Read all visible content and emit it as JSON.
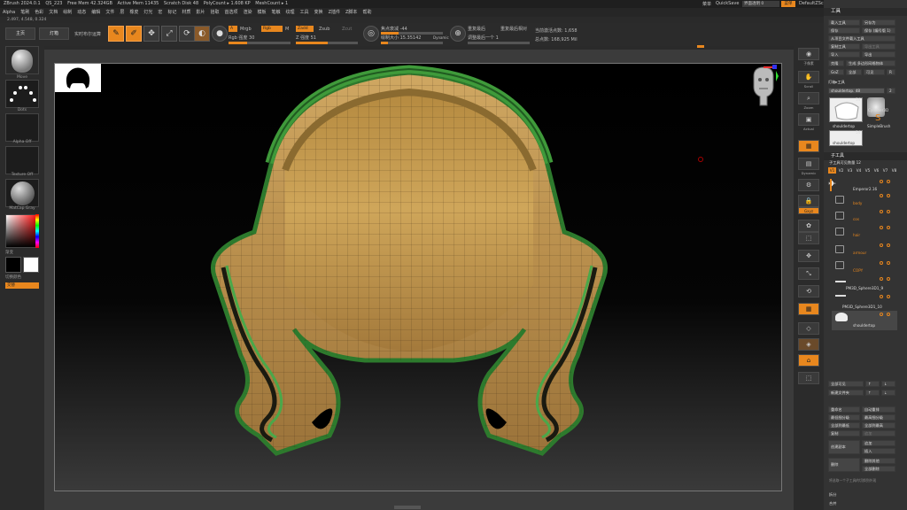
{
  "title_bar": {
    "app": "ZBrush 2024.0.1",
    "doc": "QS_223",
    "free_mem": "Free Mem 42.324GB",
    "active_mem": "Active Mem 11435",
    "scratch_disk": "Scratch Disk 48",
    "poly_count": "PolyCount ▸ 1.608 KP",
    "mesh_count": "MeshCount ▸ 1",
    "menu_label": "菜单",
    "quicksave": "QuickSave",
    "transparency": "界面透明 0",
    "ui_button": "菜单",
    "script": "DefaultZScript"
  },
  "menu": [
    "Alpha",
    "笔刷",
    "色彩",
    "文档",
    "绘制",
    "动态",
    "编辑",
    "文件",
    "层",
    "橡皮",
    "灯光",
    "宏",
    "标记",
    "材质",
    "影片",
    "拾取",
    "首选项",
    "渲染",
    "模板",
    "笔触",
    "纹理",
    "工具",
    "变换",
    "Z插件",
    "Z脚本",
    "帮助"
  ],
  "coords": "2.497, 4.548, 0.324",
  "toolbar": {
    "projection": "主页",
    "lightbox": "灯箱",
    "live_boolean": "实时布尔运算",
    "edit": "Edit",
    "draw": "Draw",
    "move": "Move",
    "scale": "Scale",
    "rotate": "Rotate",
    "a_btn": "A",
    "mrgb": "Mrgb",
    "rgb": "Rgb",
    "m": "M",
    "rgb_intensity_label": "Rgb 强度",
    "rgb_intensity": "30",
    "rgb_intensity_pct": 30,
    "zadd": "Zadd",
    "zsub": "Zsub",
    "zcut": "Zcut",
    "z_intensity_label": "Z 强度",
    "z_intensity": "51",
    "z_intensity_pct": 51,
    "focal_shift": "焦点衰减 -44",
    "focal_shift_pct": 28,
    "draw_size": "绘制大小 15.35142",
    "draw_size_pct": 12,
    "dynamic": "Dynamic",
    "active_points": "当前激活点数: 1,658",
    "total_points": "总点数: 168,925 Mil",
    "backface_mask": "重复最后",
    "backface_relative": "重复最后相对",
    "adjust_last": "调整最后一个 1"
  },
  "left_shelf": {
    "brush": "Move",
    "stroke": "Dots",
    "alpha": "Alpha Off",
    "texture": "Texture Off",
    "material": "MatCap Gray",
    "gradient": "渐变",
    "switch_color": "切换颜色",
    "alternate": "交替"
  },
  "right_shelf": {
    "bpr": "BPR",
    "sub_px": "子像素",
    "scroll": "Scroll",
    "zoom": "Zoom",
    "actual": "Actual",
    "aahalf": "AAHalf",
    "dynamic": "Dynamic",
    "persp": "Persp",
    "floor": "Floor",
    "local": "Local",
    "xyz": "Gxyz",
    "frame": "Frame",
    "move": "Move",
    "zoom3d": "Zoom3D",
    "rotate": "Rotate",
    "polyf": "PolyF",
    "transp": "Transp",
    "solo": "Solo",
    "xpose": "Xpose"
  },
  "tool_panel": {
    "header": "工具",
    "load_tool": "载入工具",
    "save_as": "另存为",
    "copy": "保存",
    "save_as2": "保存 (编号版 1)",
    "import_from_proj": "从项目文件载入工具",
    "clone": "复制工具",
    "export_tool": "导出工具",
    "import": "导入",
    "export": "导出",
    "clone2": "克隆",
    "make_polymesh": "生成 多边形网格物体",
    "goz": "GoZ",
    "all": "全部",
    "visible": "可见",
    "r": "R",
    "lightbox_tools": "灯箱▸工具",
    "current_tool": "shouldertop. 48",
    "tool_count": "2",
    "tools": [
      {
        "name": "shouldertop",
        "count": "54"
      },
      {
        "name": "Cylinder3D",
        "count": ""
      },
      {
        "name": "SimpleBrush",
        "count": ""
      },
      {
        "name": "shouldertop",
        "count": "54"
      }
    ],
    "subtool_header": "子工具",
    "subtool_visible": "子工具可见数量 12",
    "versions": [
      "V1",
      "V2",
      "V3",
      "V4",
      "V5",
      "V6",
      "V7",
      "V8"
    ],
    "subtools": [
      {
        "name": "Emperor2.16",
        "folder": false
      },
      {
        "name": "body",
        "folder": true
      },
      {
        "name": "cos",
        "folder": true
      },
      {
        "name": "hair",
        "folder": true
      },
      {
        "name": "armour",
        "folder": true
      },
      {
        "name": "COPY",
        "folder": true
      },
      {
        "name": "PM3D_Sphere3D1_9",
        "folder": false
      },
      {
        "name": "PM3D_Sphere3D1_10",
        "folder": false
      },
      {
        "name": "shouldertop",
        "folder": false
      }
    ],
    "all_low": "全部可见",
    "solo": "新建文件夹",
    "rename": "重命名",
    "auto_reorder": "自动重排",
    "all_to_low": "最低细分级",
    "all_to_high": "最高细分级",
    "all_low2": "全部到最低",
    "all_high2": "全部到最高",
    "duplicate": "复制",
    "append": "追加",
    "insert": "插入",
    "create_folder": "创建副本",
    "delete": "删除",
    "delete_other": "删除其他",
    "del_all": "全部删除",
    "footer1": "将选取一个子工具的切换到外观",
    "split": "拆分",
    "merge": "合并"
  }
}
